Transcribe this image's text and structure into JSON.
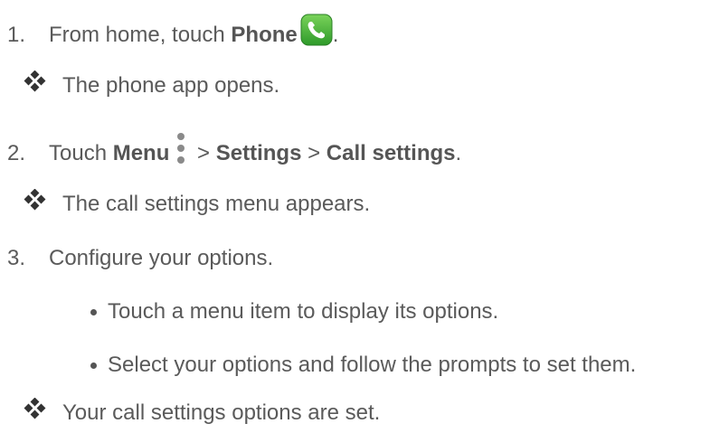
{
  "steps": [
    {
      "number": "1.",
      "prefix": "From home, touch ",
      "bold": "Phone",
      "suffix": ".",
      "result": "The phone app opens."
    },
    {
      "number": "2.",
      "prefix": "Touch ",
      "bold_menu": "Menu",
      "sep1": " > ",
      "bold_settings": "Settings",
      "sep2": " > ",
      "bold_call_settings": "Call settings",
      "suffix": ".",
      "result": "The call settings menu appears."
    },
    {
      "number": "3.",
      "text": "Configure your options.",
      "bullets": [
        "Touch a menu item to display its options.",
        "Select your options and follow the prompts to set them."
      ],
      "result": "Your call settings options are set."
    }
  ],
  "icons": {
    "phone": "phone-app-icon",
    "menu": "menu-dots-icon",
    "result_marker": "diamond-cluster-icon"
  },
  "colors": {
    "text": "#5a5a5a",
    "phone_icon_green": "#3aaa35"
  }
}
